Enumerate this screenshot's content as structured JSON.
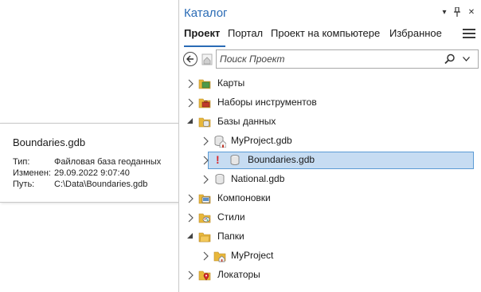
{
  "tooltip": {
    "title": "Boundaries.gdb",
    "rows": [
      {
        "key": "Тип:",
        "value": "Файловая база геоданных"
      },
      {
        "key": "Изменен:",
        "value": "29.09.2022 9:07:40"
      },
      {
        "key": "Путь:",
        "value": "C:\\Data\\Boundaries.gdb"
      }
    ]
  },
  "pane": {
    "title": "Каталог",
    "controls": {
      "dropdown": "▾",
      "pin": "📌",
      "close": "✕"
    },
    "tabs": [
      {
        "label": "Проект",
        "active": true
      },
      {
        "label": "Портал",
        "active": false
      },
      {
        "label": "Проект на компьютере",
        "active": false
      },
      {
        "label": "Избранное",
        "active": false
      }
    ],
    "search": {
      "placeholder": "Поиск Проект"
    }
  },
  "tree": [
    {
      "label": "Карты",
      "icon": "maps-folder-icon",
      "expanded": false
    },
    {
      "label": "Наборы инструментов",
      "icon": "toolboxes-folder-icon",
      "expanded": false
    },
    {
      "label": "Базы данных",
      "icon": "databases-folder-icon",
      "expanded": true
    },
    {
      "label": "MyProject.gdb",
      "icon": "geodatabase-home-icon",
      "expanded": false
    },
    {
      "label": "Boundaries.gdb",
      "icon": "geodatabase-icon",
      "expanded": false,
      "selected": true,
      "warning": "!"
    },
    {
      "label": "National.gdb",
      "icon": "geodatabase-icon",
      "expanded": false
    },
    {
      "label": "Компоновки",
      "icon": "layouts-folder-icon",
      "expanded": false
    },
    {
      "label": "Стили",
      "icon": "styles-folder-icon",
      "expanded": false
    },
    {
      "label": "Папки",
      "icon": "folders-folder-icon",
      "expanded": true
    },
    {
      "label": "MyProject",
      "icon": "project-folder-home-icon",
      "expanded": false
    },
    {
      "label": "Локаторы",
      "icon": "locators-folder-icon",
      "expanded": false
    }
  ],
  "colors": {
    "accent": "#2a6bb5",
    "selection": "#c6dcf2",
    "warning": "#d9262b",
    "folder": "#e8b73a"
  }
}
